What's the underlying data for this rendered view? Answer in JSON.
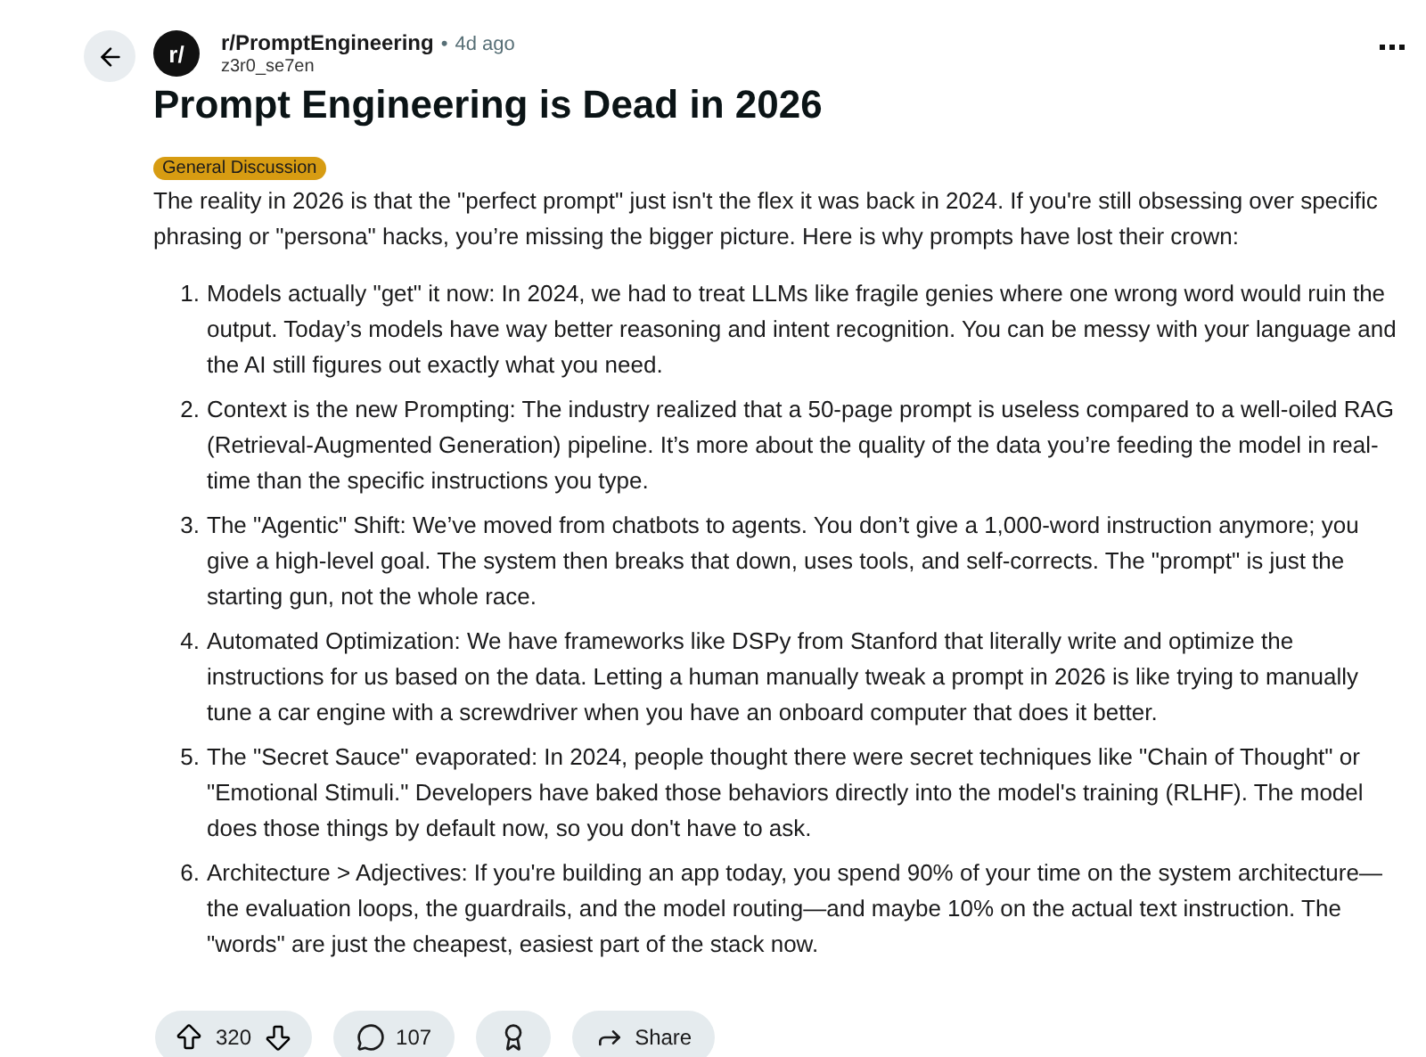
{
  "header": {
    "avatar_text": "r/",
    "subreddit": "r/PromptEngineering",
    "separator": "•",
    "age": "4d ago",
    "author": "z3r0_se7en"
  },
  "title": "Prompt Engineering is Dead in 2026",
  "flair": {
    "label": "General Discussion",
    "color": "#d79c12"
  },
  "intro": "The reality in 2026 is that the \"perfect prompt\" just isn't the flex it was back in 2024. If you're still obsessing over specific phrasing or \"persona\" hacks, you’re missing the bigger picture. Here is why prompts have lost their crown:",
  "points": [
    {
      "number": "1.",
      "text": "Models actually \"get\" it now: In 2024, we had to treat LLMs like fragile genies where one wrong word would ruin the output. Today’s models have way better reasoning and intent recognition. You can be messy with your language and the AI still figures out exactly what you need."
    },
    {
      "number": "2.",
      "text": "Context is the new Prompting: The industry realized that a 50-page prompt is useless compared to a well-oiled RAG (Retrieval-Augmented Generation) pipeline. It’s more about the quality of the data you’re feeding the model in real-time than the specific instructions you type."
    },
    {
      "number": "3.",
      "text": "The \"Agentic\" Shift: We’ve moved from chatbots to agents. You don’t give a 1,000-word instruction anymore; you give a high-level goal. The system then breaks that down, uses tools, and self-corrects. The \"prompt\" is just the starting gun, not the whole race."
    },
    {
      "number": "4.",
      "text": "Automated Optimization: We have frameworks like DSPy from Stanford that literally write and optimize the instructions for us based on the data. Letting a human manually tweak a prompt in 2026 is like trying to manually tune a car engine with a screwdriver when you have an onboard computer that does it better."
    },
    {
      "number": "5.",
      "text": "The \"Secret Sauce\" evaporated: In 2024, people thought there were secret techniques like \"Chain of Thought\" or \"Emotional Stimuli.\" Developers have baked those behaviors directly into the model's training (RLHF). The model does those things by default now, so you don't have to ask."
    },
    {
      "number": "6.",
      "text": "Architecture > Adjectives: If you're building an app today, you spend 90% of your time on the system architecture—the evaluation loops, the guardrails, and the model routing—and maybe 10% on the actual text instruction. The \"words\" are just the cheapest, easiest part of the stack now."
    }
  ],
  "actions": {
    "votes": "320",
    "comments": "107",
    "share": "Share"
  }
}
